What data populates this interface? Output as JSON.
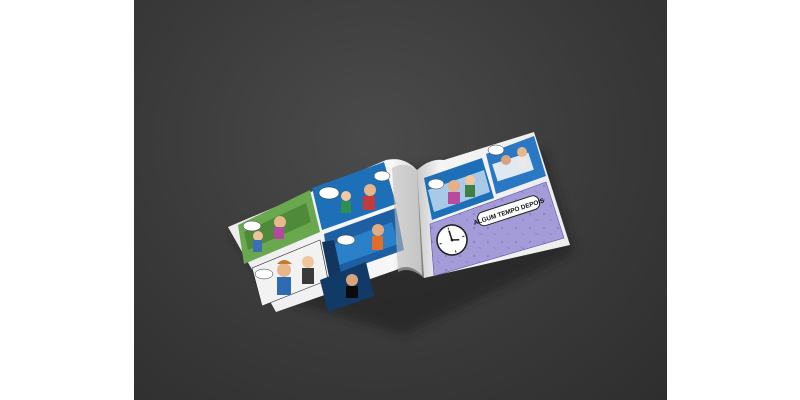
{
  "scene": {
    "background_color": "#3d3d3d",
    "subject": "comic-book-mockup"
  },
  "comic": {
    "caption": "ALGUM TEMPO DEPOIS",
    "accent_color": "#9d94d6",
    "panel_blue": "#1d6fb8",
    "clock_icon": "clock-icon"
  }
}
